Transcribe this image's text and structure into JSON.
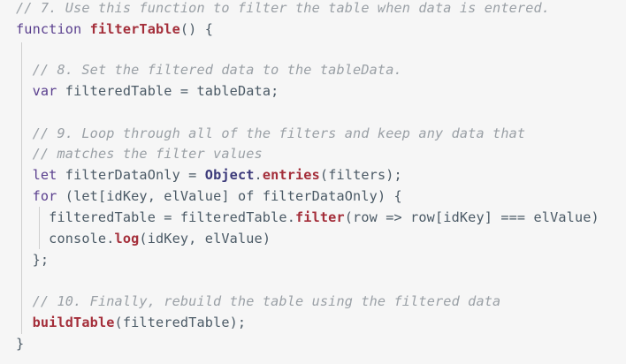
{
  "lines": [
    {
      "tokens": [
        {
          "t": "comment",
          "v": "// 7. Use this function to filter the table when data is entered."
        }
      ]
    },
    {
      "tokens": [
        {
          "t": "kw",
          "v": "function "
        },
        {
          "t": "fn",
          "v": "filterTable"
        },
        {
          "t": "ident",
          "v": "() {"
        }
      ]
    },
    {
      "tokens": []
    },
    {
      "tokens": [
        {
          "t": "ident",
          "v": "  "
        },
        {
          "t": "comment",
          "v": "// 8. Set the filtered data to the tableData."
        }
      ]
    },
    {
      "tokens": [
        {
          "t": "ident",
          "v": "  "
        },
        {
          "t": "kw",
          "v": "var "
        },
        {
          "t": "ident",
          "v": "filteredTable = tableData;"
        }
      ]
    },
    {
      "tokens": []
    },
    {
      "tokens": [
        {
          "t": "ident",
          "v": "  "
        },
        {
          "t": "comment",
          "v": "// 9. Loop through all of the filters and keep any data that"
        }
      ]
    },
    {
      "tokens": [
        {
          "t": "ident",
          "v": "  "
        },
        {
          "t": "comment",
          "v": "// matches the filter values"
        }
      ]
    },
    {
      "tokens": [
        {
          "t": "ident",
          "v": "  "
        },
        {
          "t": "kw",
          "v": "let "
        },
        {
          "t": "ident",
          "v": "filterDataOnly = "
        },
        {
          "t": "obj",
          "v": "Object"
        },
        {
          "t": "ident",
          "v": "."
        },
        {
          "t": "fn",
          "v": "entries"
        },
        {
          "t": "ident",
          "v": "(filters);"
        }
      ]
    },
    {
      "tokens": [
        {
          "t": "ident",
          "v": "  "
        },
        {
          "t": "kw",
          "v": "for "
        },
        {
          "t": "ident",
          "v": "(let[idKey, elValue] of filterDataOnly) {"
        }
      ]
    },
    {
      "tokens": [
        {
          "t": "ident",
          "v": "    filteredTable = filteredTable."
        },
        {
          "t": "fn",
          "v": "filter"
        },
        {
          "t": "ident",
          "v": "(row => row[idKey] === elValue)"
        }
      ]
    },
    {
      "tokens": [
        {
          "t": "ident",
          "v": "    console."
        },
        {
          "t": "fn",
          "v": "log"
        },
        {
          "t": "ident",
          "v": "(idKey, elValue)"
        }
      ]
    },
    {
      "tokens": [
        {
          "t": "ident",
          "v": "  };"
        }
      ]
    },
    {
      "tokens": []
    },
    {
      "tokens": [
        {
          "t": "ident",
          "v": "  "
        },
        {
          "t": "comment",
          "v": "// 10. Finally, rebuild the table using the filtered data"
        }
      ]
    },
    {
      "tokens": [
        {
          "t": "ident",
          "v": "  "
        },
        {
          "t": "fn",
          "v": "buildTable"
        },
        {
          "t": "ident",
          "v": "(filteredTable);"
        }
      ]
    },
    {
      "tokens": [
        {
          "t": "ident",
          "v": "}"
        }
      ]
    }
  ]
}
